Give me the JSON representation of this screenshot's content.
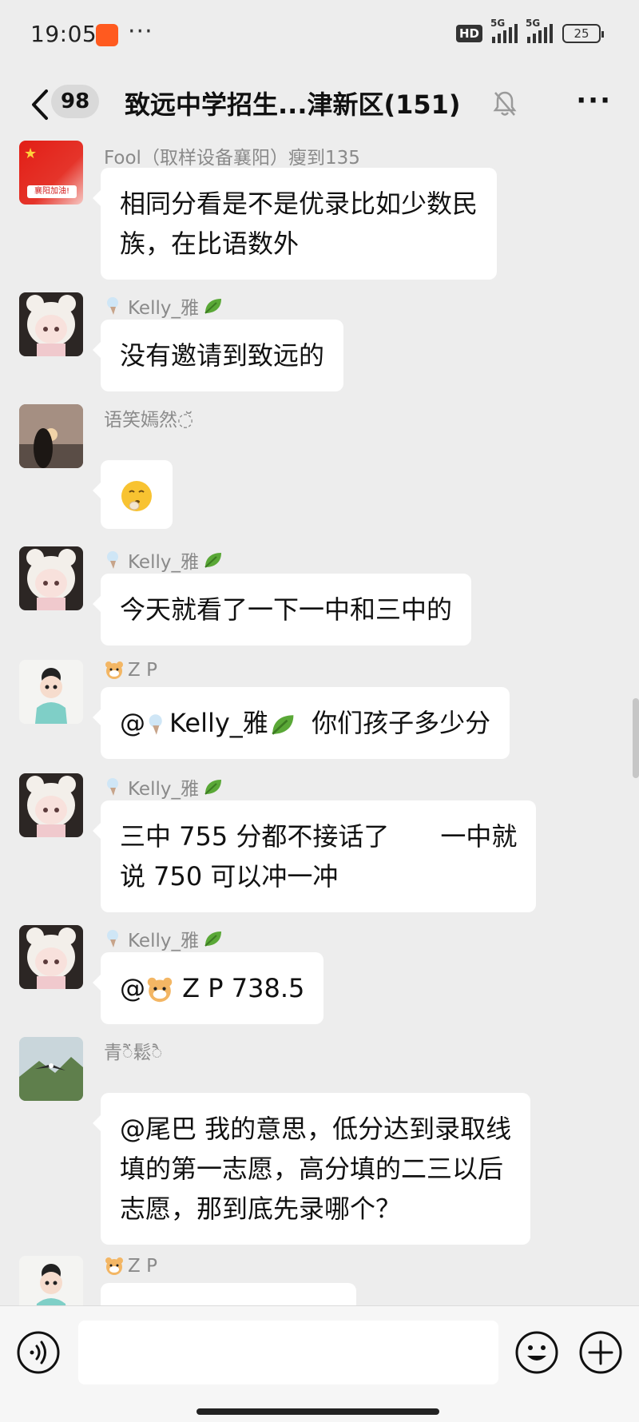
{
  "status_bar": {
    "time": "19:05",
    "app_icon": "app-notification-icon",
    "more": "···",
    "hd": "HD",
    "network_1": "5G",
    "network_2": "5G",
    "battery": "25"
  },
  "header": {
    "unread_count": "98",
    "title": "致远中学招生...津新区(151)",
    "back_icon": "chevron-left-icon",
    "mute_icon": "bell-muted-icon",
    "menu": "···"
  },
  "messages": [
    {
      "sender": "Fool（取样设备襄阳）瘦到135",
      "avatar": "flag-avatar",
      "avatar_text": "襄阳加油!",
      "text_lines": [
        "相同分看是不是优录比如少数民",
        "族，在比语数外"
      ]
    },
    {
      "sender": "Kelly_雅",
      "avatar": "bear-hood-girl-avatar",
      "text_lines": [
        "没有邀请到致远的"
      ]
    },
    {
      "sender": "语笑嫣然◌̆",
      "avatar": "heart-hands-sunset-avatar",
      "emoji": "shushing-face-emoji"
    },
    {
      "sender": "Kelly_雅",
      "avatar": "bear-hood-girl-avatar",
      "text_lines": [
        "今天就看了一下一中和三中的"
      ]
    },
    {
      "sender": "Z P",
      "avatar": "cartoon-doll-avatar",
      "mention": "@",
      "mention_name": "Kelly_雅",
      "text_after": "你们孩子多少分"
    },
    {
      "sender": "Kelly_雅",
      "avatar": "bear-hood-girl-avatar",
      "text_lines": [
        "三中 755 分都不接话了　　一中就",
        "说 750 可以冲一冲"
      ]
    },
    {
      "sender": "Kelly_雅",
      "avatar": "bear-hood-girl-avatar",
      "mention": "@",
      "text_after": "Z P 738.5"
    },
    {
      "sender": "青ैं鬆ै",
      "avatar": "eagle-mountain-avatar",
      "text_lines": [
        "@尾巴  我的意思，低分达到录取线",
        "填的第一志愿，高分填的二三以后",
        "志愿，那到底先录哪个？"
      ]
    },
    {
      "sender": "Z P",
      "avatar": "cartoon-doll-avatar",
      "text_lines": [
        ""
      ]
    }
  ],
  "input_bar": {
    "voice_icon": "voice-input-icon",
    "placeholder": "",
    "emoji_icon": "emoji-smile-icon",
    "plus_icon": "plus-circle-icon"
  }
}
